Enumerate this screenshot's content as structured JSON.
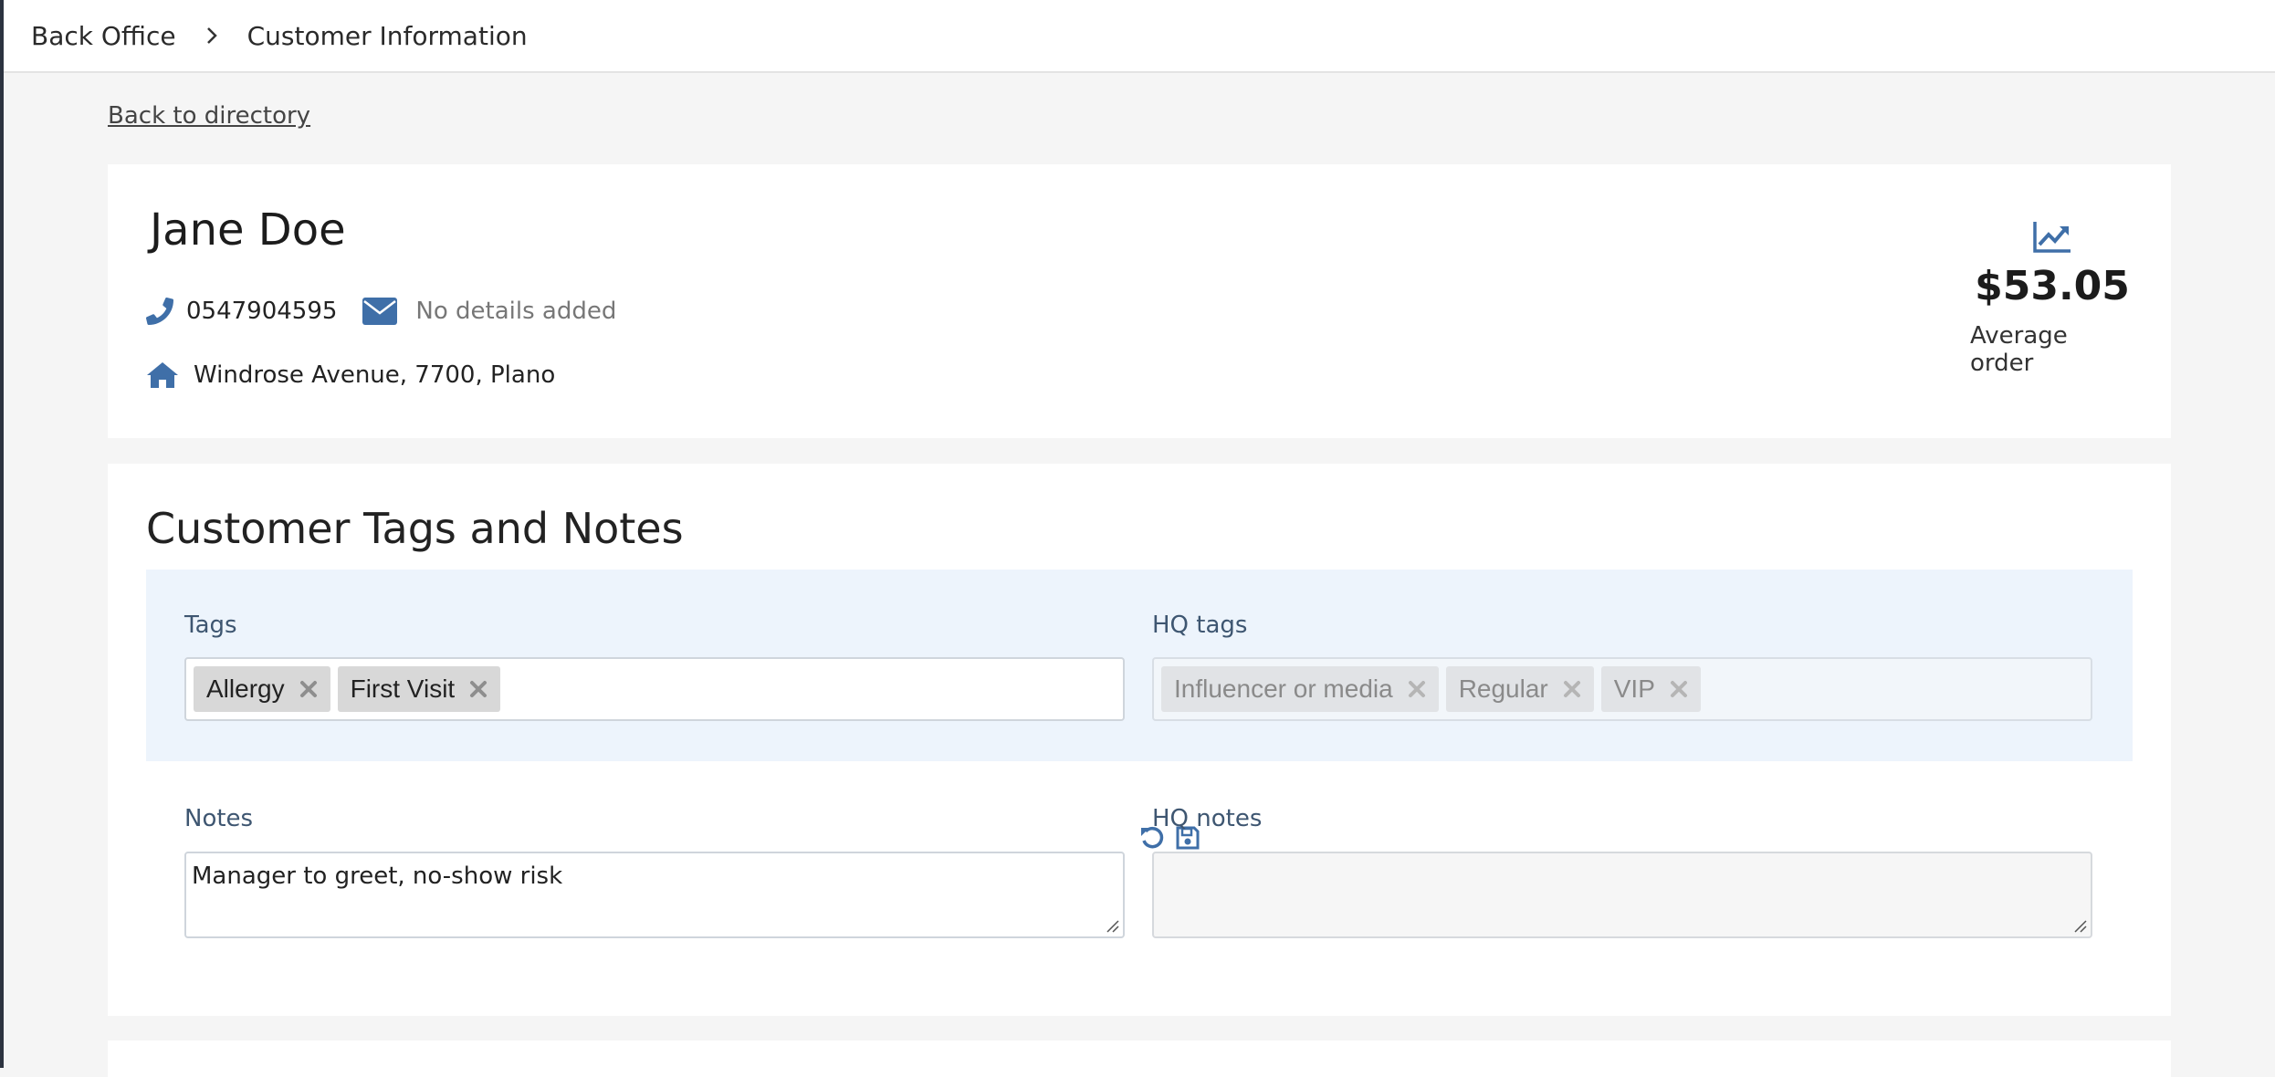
{
  "breadcrumb": {
    "root": "Back Office",
    "current": "Customer Information"
  },
  "back_link": "Back to directory",
  "customer": {
    "name": "Jane Doe",
    "phone": "0547904595",
    "email": "No details added",
    "address": "Windrose Avenue, 7700, Plano"
  },
  "stats": {
    "average_order_value": "$53.05",
    "average_order_label": "Average order",
    "icon": "line-chart-icon"
  },
  "tags_section": {
    "title": "Customer Tags and Notes",
    "tags_label": "Tags",
    "tags": [
      "Allergy",
      "First Visit"
    ],
    "hq_tags_label": "HQ tags",
    "hq_tags": [
      "Influencer or media",
      "Regular",
      "VIP"
    ],
    "notes_label": "Notes",
    "notes_value": "Manager to greet, no-show risk",
    "hq_notes_label": "HQ notes",
    "hq_notes_value": ""
  },
  "colors": {
    "accent": "#3f6fa8",
    "label": "#3e5671",
    "panel": "#edf4fc"
  }
}
